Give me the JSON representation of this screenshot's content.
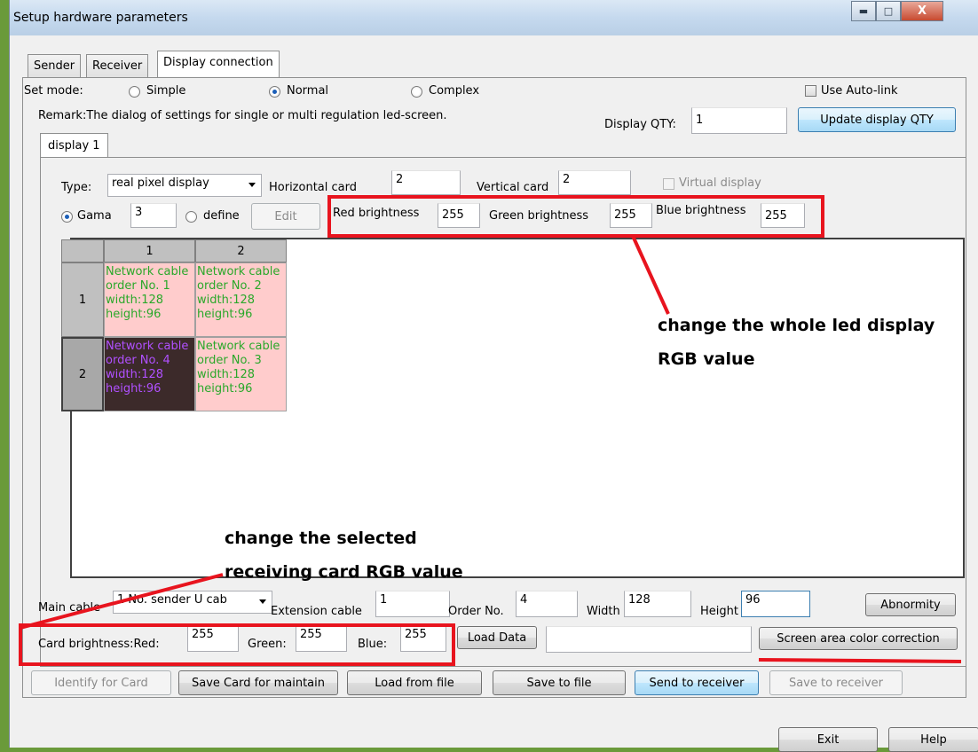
{
  "window": {
    "title": "Setup hardware parameters"
  },
  "tabs": [
    "Sender",
    "Receiver",
    "Display connection"
  ],
  "mode": {
    "label": "Set mode:",
    "options": [
      "Simple",
      "Normal",
      "Complex"
    ],
    "selected": "Normal",
    "auto_link_label": "Use Auto-link"
  },
  "remark": "Remark:The dialog of settings for single or multi  regulation led-screen.",
  "display_qty": {
    "label": "Display QTY:",
    "value": "1",
    "button": "Update display QTY"
  },
  "display_tab": "display 1",
  "display": {
    "type_label": "Type:",
    "type_value": "real pixel display",
    "horizontal_label": "Horizontal card",
    "horizontal_value": "2",
    "vertical_label": "Vertical card",
    "vertical_value": "2",
    "virtual_label": "Virtual display",
    "gama_label": "Gama",
    "gama_value": "3",
    "define_label": "define",
    "edit_label": "Edit",
    "red_label": "Red brightness",
    "red_value": "255",
    "green_label": "Green brightness",
    "green_value": "255",
    "blue_label": "Blue brightness",
    "blue_value": "255"
  },
  "grid": {
    "col_headers": [
      "1",
      "2"
    ],
    "row_headers": [
      "1",
      "2"
    ],
    "cells": [
      [
        "Network cable",
        "order No. 1",
        "width:128",
        "height:96"
      ],
      [
        "Network cable",
        "order No. 2",
        "width:128",
        "height:96"
      ],
      [
        "Network cable",
        "order No. 4",
        "width:128",
        "height:96"
      ],
      [
        "Network cable",
        "order No. 3",
        "width:128",
        "height:96"
      ]
    ]
  },
  "annotations": {
    "whole_line1": "change the whole led display",
    "whole_line2": "RGB value",
    "selected_line1": "change the selected",
    "selected_line2": "receiving card RGB value"
  },
  "card": {
    "main_cable_label": "Main cable",
    "main_cable_value": "1 No. sender U cab",
    "extension_label": "Extension cable",
    "extension_value": "1",
    "order_label": "Order No.",
    "order_value": "4",
    "width_label": "Width",
    "width_value": "128",
    "height_label": "Height",
    "height_value": "96",
    "abnormity_button": "Abnormity",
    "brightness_label": "Card brightness:Red:",
    "red_value": "255",
    "green_label": "Green:",
    "green_value": "255",
    "blue_label": "Blue:",
    "blue_value": "255",
    "load_data_button": "Load Data",
    "load_data_value": "",
    "color_correction_button": "Screen area color correction"
  },
  "actions": {
    "identify": "Identify for Card",
    "save_maintain": "Save Card for maintain",
    "load_file": "Load from file",
    "save_file": "Save to file",
    "send_receiver": "Send to receiver",
    "save_receiver": "Save to receiver"
  },
  "footer": {
    "exit": "Exit",
    "help": "Help"
  },
  "colors": {
    "annotation_red": "#e8141e",
    "cell_text": "#2aa82a",
    "cell_bg": "#ffcccc",
    "selected_text": "#b050ff"
  }
}
